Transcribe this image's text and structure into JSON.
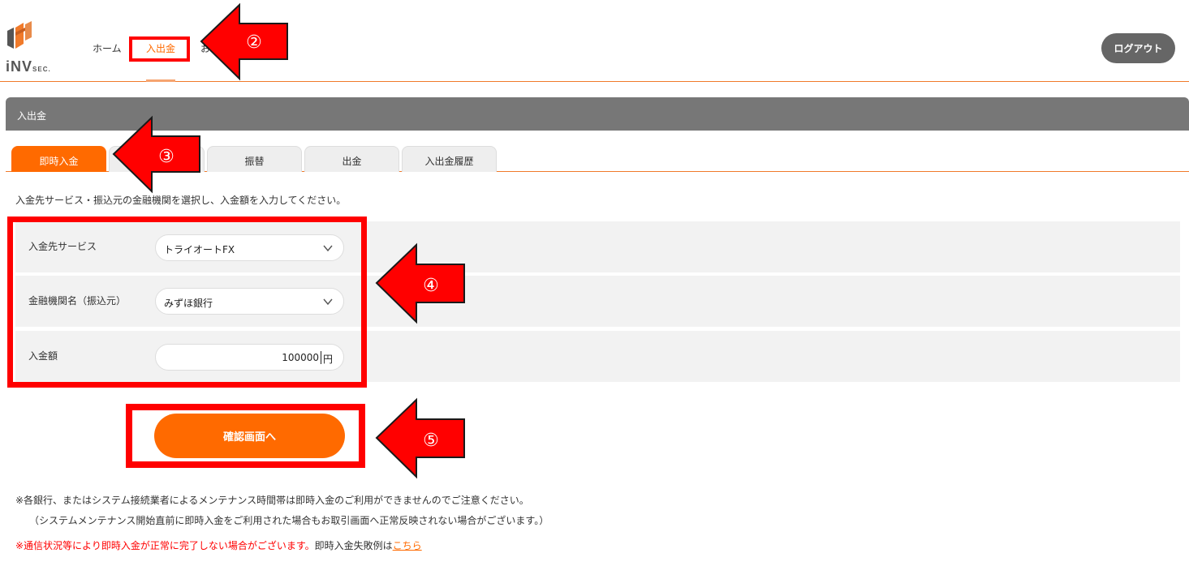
{
  "header": {
    "logo_text": "iNV",
    "logo_sub": "SEC.",
    "nav": {
      "home": "ホーム",
      "deposit": "入出金",
      "other": "お"
    },
    "logout_label": "ログアウト"
  },
  "panel": {
    "title": "入出金"
  },
  "tabs": {
    "instant": "即時入金",
    "transfer": "振替",
    "withdraw": "出金",
    "history": "入出金履歴"
  },
  "form": {
    "instruction": "入金先サービス・振込元の金融機関を選択し、入金額を入力してください。",
    "service_label": "入金先サービス",
    "service_value": "トライオートFX",
    "bank_label": "金融機関名（振込元）",
    "bank_value": "みずほ銀行",
    "amount_label": "入金額",
    "amount_value": "100000",
    "amount_unit": "円"
  },
  "confirm_label": "確認画面へ",
  "notes": {
    "line1": "※各銀行、またはシステム接続業者によるメンテナンス時間帯は即時入金のご利用ができませんのでご注意ください。",
    "line2": "（システムメンテナンス開始直前に即時入金をご利用された場合もお取引画面へ正常反映されない場合がございます。）",
    "line3_red": "※通信状況等により即時入金が正常に完了しない場合がございます。",
    "line3_plain": "即時入金失敗例は",
    "line3_link": "こちら"
  },
  "annotations": {
    "step2": "②",
    "step3": "③",
    "step4": "④",
    "step5": "⑤"
  },
  "colors": {
    "accent": "#ff6a00",
    "highlight": "#ff0000",
    "panel_head": "#777777",
    "logo": "#f07a2a"
  }
}
